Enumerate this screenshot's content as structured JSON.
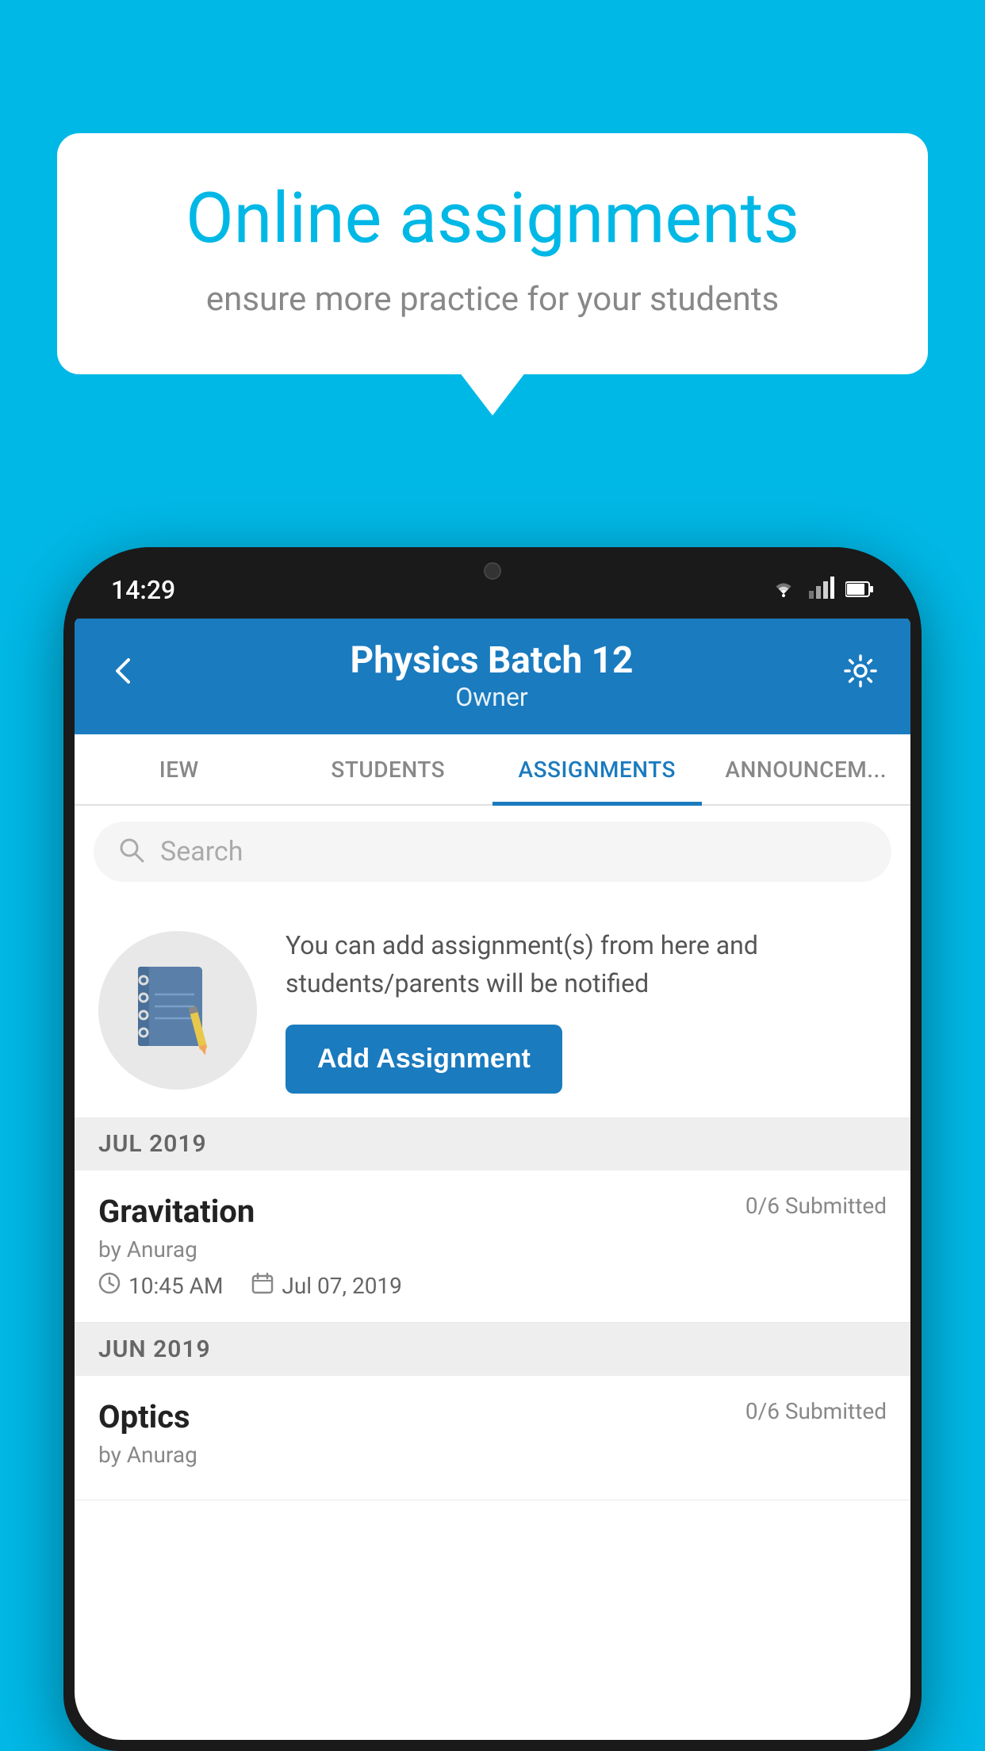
{
  "background_color": "#00b8e6",
  "speech_bubble": {
    "title": "Online assignments",
    "subtitle": "ensure more practice for your students"
  },
  "status_bar": {
    "time": "14:29",
    "icons": [
      "wifi",
      "signal",
      "battery"
    ]
  },
  "app_bar": {
    "title": "Physics Batch 12",
    "subtitle": "Owner",
    "back_label": "←",
    "settings_label": "⚙"
  },
  "tabs": [
    {
      "label": "IEW",
      "active": false
    },
    {
      "label": "STUDENTS",
      "active": false
    },
    {
      "label": "ASSIGNMENTS",
      "active": true
    },
    {
      "label": "ANNOUNCEM...",
      "active": false
    }
  ],
  "search": {
    "placeholder": "Search"
  },
  "empty_state": {
    "description": "You can add assignment(s) from here and students/parents will be notified",
    "add_button_label": "Add Assignment"
  },
  "sections": [
    {
      "header": "JUL 2019",
      "assignments": [
        {
          "name": "Gravitation",
          "submitted": "0/6 Submitted",
          "author": "by Anurag",
          "time": "10:45 AM",
          "date": "Jul 07, 2019"
        }
      ]
    },
    {
      "header": "JUN 2019",
      "assignments": [
        {
          "name": "Optics",
          "submitted": "0/6 Submitted",
          "author": "by Anurag",
          "time": "",
          "date": ""
        }
      ]
    }
  ]
}
